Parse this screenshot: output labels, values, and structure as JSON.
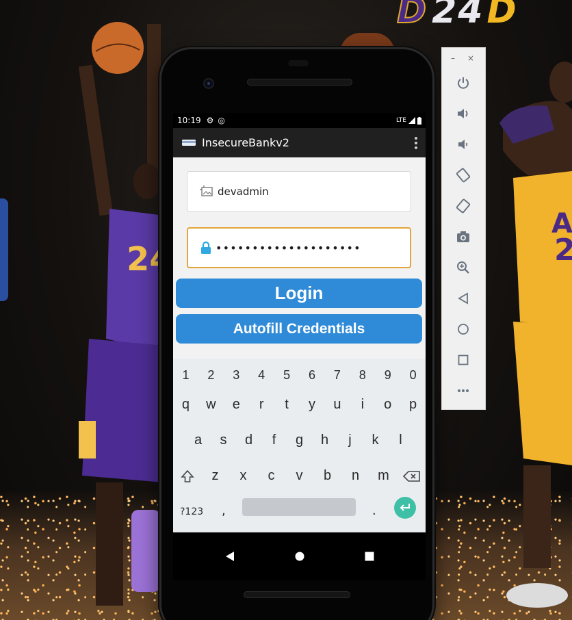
{
  "wallpaper": {
    "logo_text": "24"
  },
  "status_bar": {
    "time": "10:19",
    "network": "LTE"
  },
  "app_bar": {
    "title": "InsecureBankv2"
  },
  "login_form": {
    "username_value": "devadmin",
    "password_value": "••••••••••••••••••••",
    "login_label": "Login",
    "autofill_label": "Autofill Credentials"
  },
  "keyboard": {
    "numbers": [
      "1",
      "2",
      "3",
      "4",
      "5",
      "6",
      "7",
      "8",
      "9",
      "0"
    ],
    "row1": [
      "q",
      "w",
      "e",
      "r",
      "t",
      "y",
      "u",
      "i",
      "o",
      "p"
    ],
    "row2": [
      "a",
      "s",
      "d",
      "f",
      "g",
      "h",
      "j",
      "k",
      "l"
    ],
    "row3": [
      "z",
      "x",
      "c",
      "v",
      "b",
      "n",
      "m"
    ],
    "symbols_label": "?123",
    "comma": ",",
    "period": "."
  },
  "emulator_toolbar": {
    "window_controls": [
      "–",
      "×"
    ],
    "tools": [
      "power-icon",
      "volume-up-icon",
      "volume-down-icon",
      "rotate-left-icon",
      "rotate-right-icon",
      "camera-icon",
      "zoom-icon",
      "back-icon",
      "home-icon",
      "overview-icon",
      "more-icon"
    ]
  },
  "colors": {
    "accent_button": "#2f8bd8",
    "focus_border": "#e3a43a",
    "enter_key": "#3ec0a6",
    "lock_icon": "#2fa9e0"
  }
}
